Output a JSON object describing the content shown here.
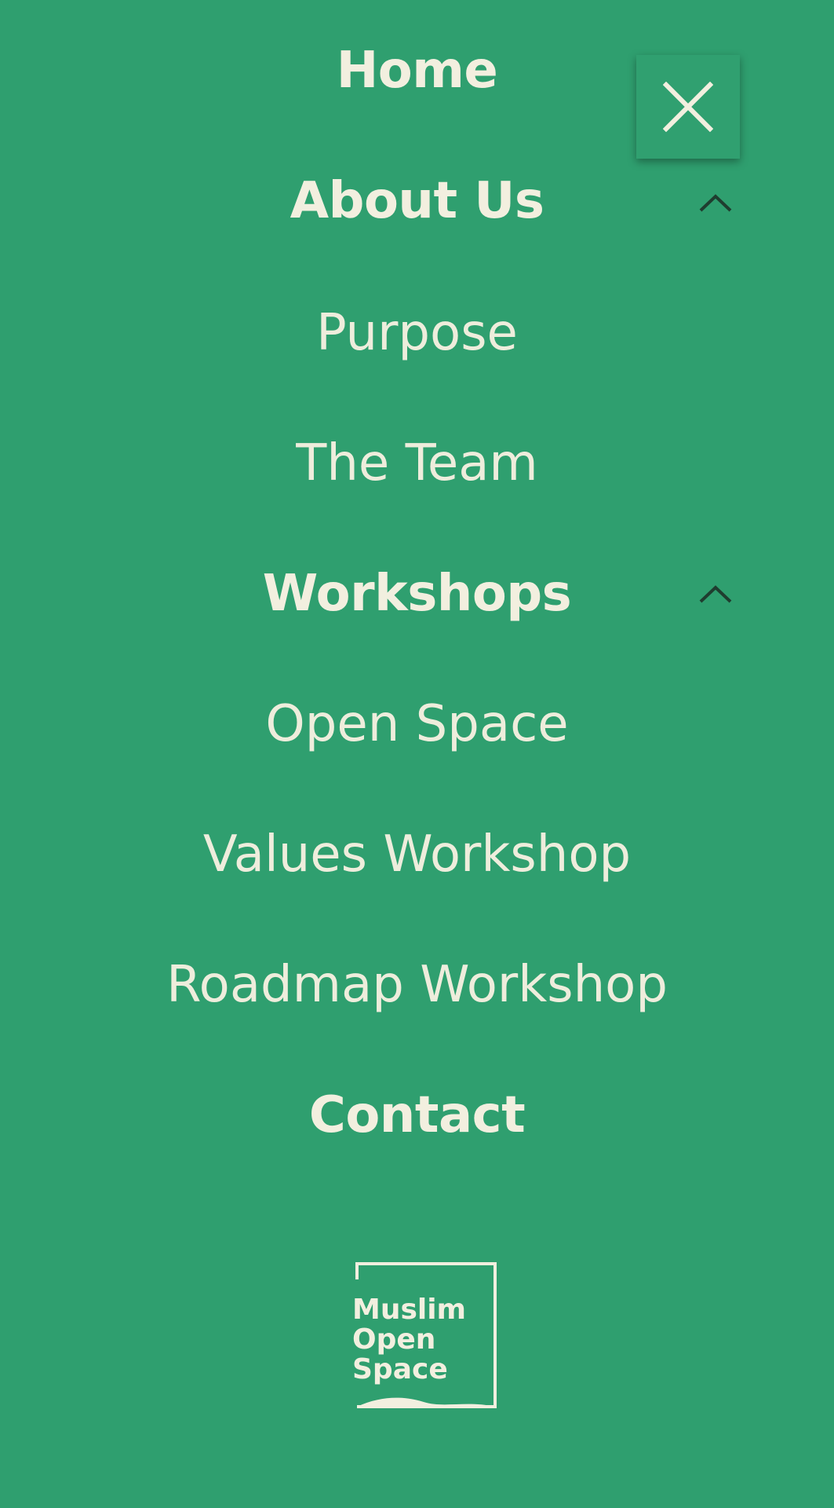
{
  "nav": {
    "home": "Home",
    "about": "About Us",
    "purpose": "Purpose",
    "team": "The Team",
    "workshops": "Workshops",
    "open_space": "Open Space",
    "values_workshop": "Values Workshop",
    "roadmap_workshop": "Roadmap Workshop",
    "contact": "Contact"
  },
  "logo": {
    "line1": "Muslim",
    "line2": "Open",
    "line3": "Space"
  },
  "icons": {
    "close": "close-icon",
    "about_toggle": "chevron-up-icon",
    "workshops_toggle": "chevron-up-icon"
  },
  "colors": {
    "background": "#2f9f6f",
    "text": "#f2efdf",
    "chevron": "#1f3d2f"
  }
}
